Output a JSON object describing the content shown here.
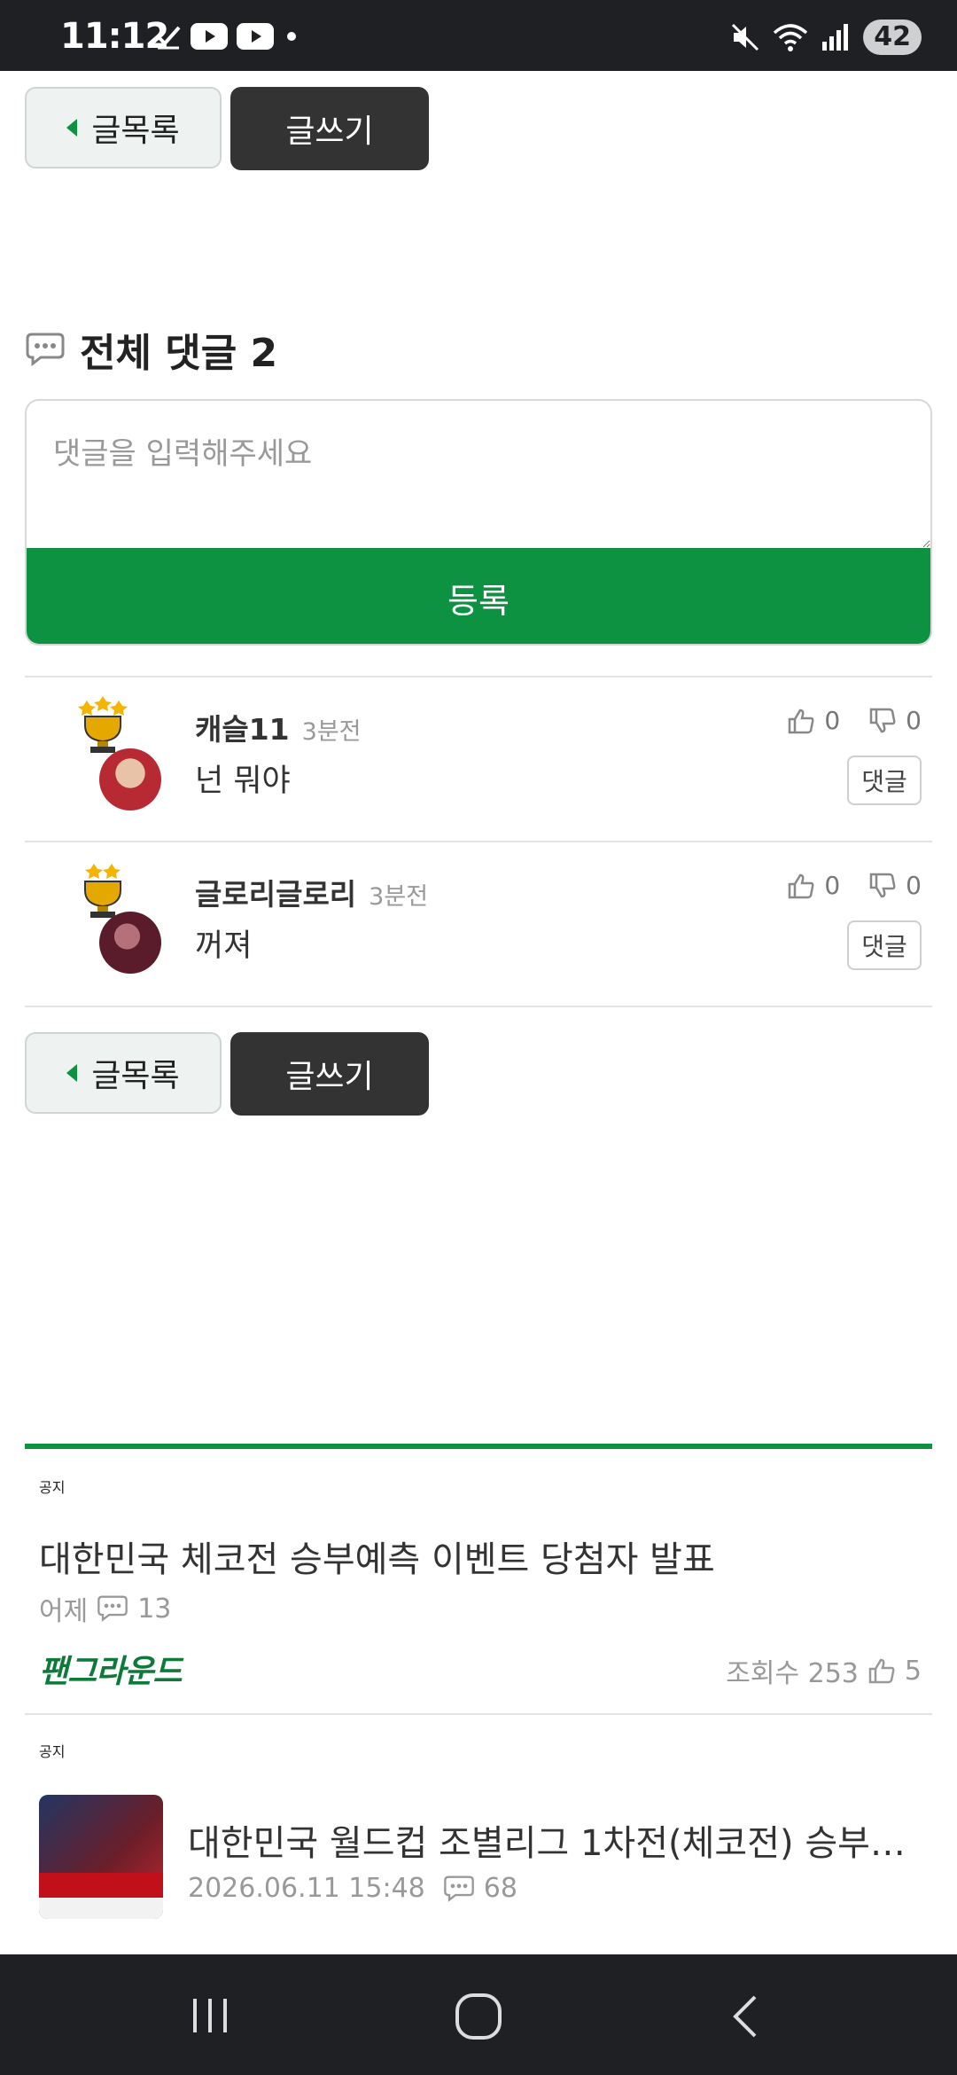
{
  "status_bar": {
    "time": "11:12",
    "battery": "42",
    "left_icons": [
      "check-icon",
      "youtube-icon",
      "youtube-icon",
      "dot-icon"
    ],
    "right_icons": [
      "mute-icon",
      "wifi-icon",
      "signal-icon"
    ]
  },
  "buttons": {
    "list_label": "글목록",
    "write_label": "글쓰기"
  },
  "comments_section": {
    "title": "전체 댓글 2",
    "input_placeholder": "댓글을 입력해주세요",
    "submit_label": "등록",
    "items": [
      {
        "author": "캐슬11",
        "time": "3분전",
        "text": "넌 뭐야",
        "likes": "0",
        "dislikes": "0",
        "reply_label": "댓글",
        "trophy_stars": 3
      },
      {
        "author": "글로리글로리",
        "time": "3분전",
        "text": "꺼져",
        "likes": "0",
        "dislikes": "0",
        "reply_label": "댓글",
        "trophy_stars": 2
      }
    ]
  },
  "notices": [
    {
      "label": "공지",
      "title": "대한민국 체코전 승부예측 이벤트 당첨자 발표",
      "date": "어제",
      "comments": "13",
      "brand": "팬그라운드",
      "views": "조회수 253",
      "likes": "5"
    },
    {
      "label": "공지",
      "title": "대한민국 월드컵 조별리그 1차전(체코전) 승부…",
      "date": "2026.06.11 15:48",
      "comments": "68"
    }
  ],
  "colors": {
    "accent": "#0d9242",
    "dark_button": "#333333",
    "status_bar": "#1f2024"
  }
}
